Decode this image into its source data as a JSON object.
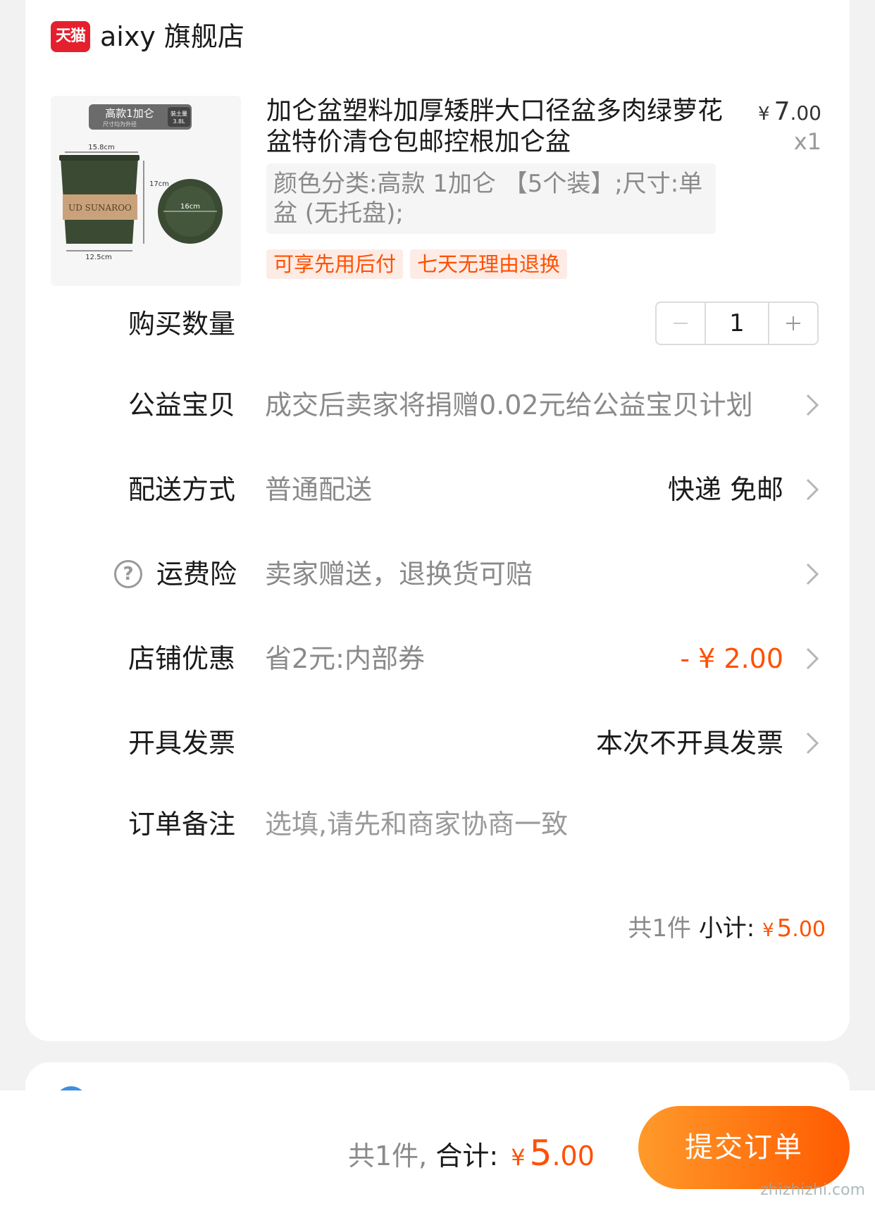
{
  "shop": {
    "badge": "天猫",
    "name": "aixy 旗舰店"
  },
  "product": {
    "image_labels": {
      "banner_title": "高款1加仑",
      "banner_sub": "尺寸均为外径",
      "banner_badge_top": "装土量",
      "banner_badge_bottom": "3.8L",
      "top_width": "15.8cm",
      "height": "17cm",
      "saucer": "16cm",
      "bottom_width": "12.5cm",
      "brand": "UD SUNAROO"
    },
    "title": "加仑盆塑料加厚矮胖大口径盆多肉绿萝花盆特价清仓包邮控根加仑盆",
    "price": {
      "symbol": "¥",
      "int": "7",
      "cents": ".00"
    },
    "quantity": "x1",
    "sku": "颜色分类:高款 1加仑 【5个装】;尺寸:单盆 (无托盘);",
    "tags": [
      "可享先用后付",
      "七天无理由退换"
    ]
  },
  "rows": {
    "qty": {
      "label": "购买数量",
      "value": "1"
    },
    "charity": {
      "label": "公益宝贝",
      "desc": "成交后卖家将捐赠0.02元给公益宝贝计划"
    },
    "delivery": {
      "label": "配送方式",
      "desc": "普通配送",
      "right": "快递 免邮"
    },
    "insurance": {
      "label": "运费险",
      "desc": "卖家赠送，退换货可赔"
    },
    "discount": {
      "label": "店铺优惠",
      "desc": "省2元:内部券",
      "right": "- ¥ 2.00"
    },
    "invoice": {
      "label": "开具发票",
      "right": "本次不开具发票"
    },
    "note": {
      "label": "订单备注",
      "placeholder": "选填,请先和商家协商一致"
    }
  },
  "subtotal": {
    "count": "共1件",
    "label": "小计:",
    "symbol": "¥",
    "int": "5",
    "cents": ".00"
  },
  "footer": {
    "count": "共1件,",
    "label": "合计:",
    "symbol": "¥",
    "int": "5",
    "cents": ".00",
    "submit": "提交订单",
    "watermark": "zhizhizhi.com"
  },
  "colors": {
    "accent": "#ff5000",
    "tmall_red": "#e5202e",
    "pot_green": "#3b4a33"
  }
}
